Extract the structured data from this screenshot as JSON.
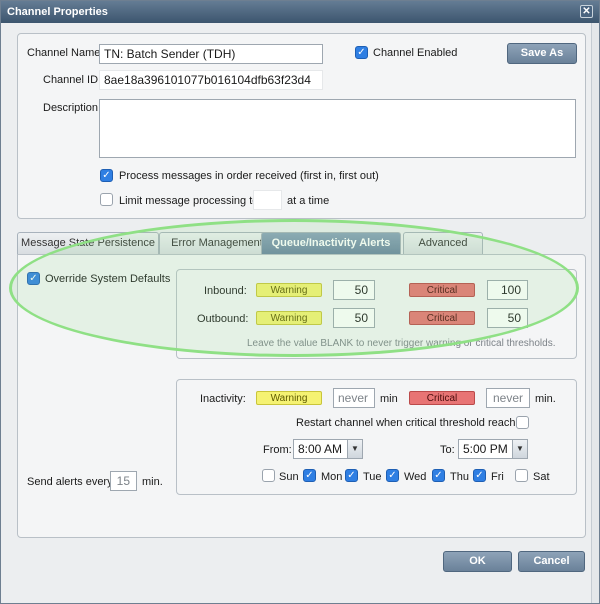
{
  "window": {
    "title": "Channel Properties",
    "close_glyph": "✕"
  },
  "top": {
    "channel_name_label": "Channel Name:",
    "channel_name_value": "TN: Batch Sender (TDH)",
    "channel_enabled_label": "Channel Enabled",
    "save_as_label": "Save As",
    "channel_id_label": "Channel ID:",
    "channel_id_value": "8ae18a396101077b016104dfb63f23d4",
    "description_label": "Description:",
    "process_in_order_label": "Process messages in order received (first in, first out)",
    "limit_label": "Limit message processing to",
    "limit_suffix": "at a time"
  },
  "tabs": [
    {
      "label": "Message State Persistence"
    },
    {
      "label": "Error Management"
    },
    {
      "label": "Queue/Inactivity Alerts"
    },
    {
      "label": "Advanced"
    }
  ],
  "queue": {
    "override_label": "Override System Defaults",
    "inbound_label": "Inbound:",
    "outbound_label": "Outbound:",
    "warning_label": "Warning",
    "critical_label": "Critical",
    "inbound_warning": "50",
    "inbound_critical": "100",
    "outbound_warning": "50",
    "outbound_critical": "50",
    "hint": "Leave the value BLANK to never trigger warning or critical thresholds."
  },
  "inactivity": {
    "label": "Inactivity:",
    "warning_label": "Warning",
    "critical_label": "Critical",
    "warning_value": "never",
    "critical_value": "never",
    "min_unit": "min",
    "min_unit_dot": "min.",
    "restart_label": "Restart channel when critical threshold reached",
    "from_label": "From:",
    "from_value": "8:00 AM",
    "to_label": "To:",
    "to_value": "5:00 PM",
    "days": [
      {
        "label": "Sun",
        "checked": false
      },
      {
        "label": "Mon",
        "checked": true
      },
      {
        "label": "Tue",
        "checked": true
      },
      {
        "label": "Wed",
        "checked": true
      },
      {
        "label": "Thu",
        "checked": true
      },
      {
        "label": "Fri",
        "checked": true
      },
      {
        "label": "Sat",
        "checked": false
      }
    ]
  },
  "alerts": {
    "send_every_label": "Send alerts every",
    "send_every_value": "15",
    "unit": "min."
  },
  "footer": {
    "ok_label": "OK",
    "cancel_label": "Cancel"
  },
  "colors": {
    "accent": "#2f7fe3",
    "warning": "#f5f272",
    "critical": "#e87474",
    "highlight": "#8fe085"
  }
}
